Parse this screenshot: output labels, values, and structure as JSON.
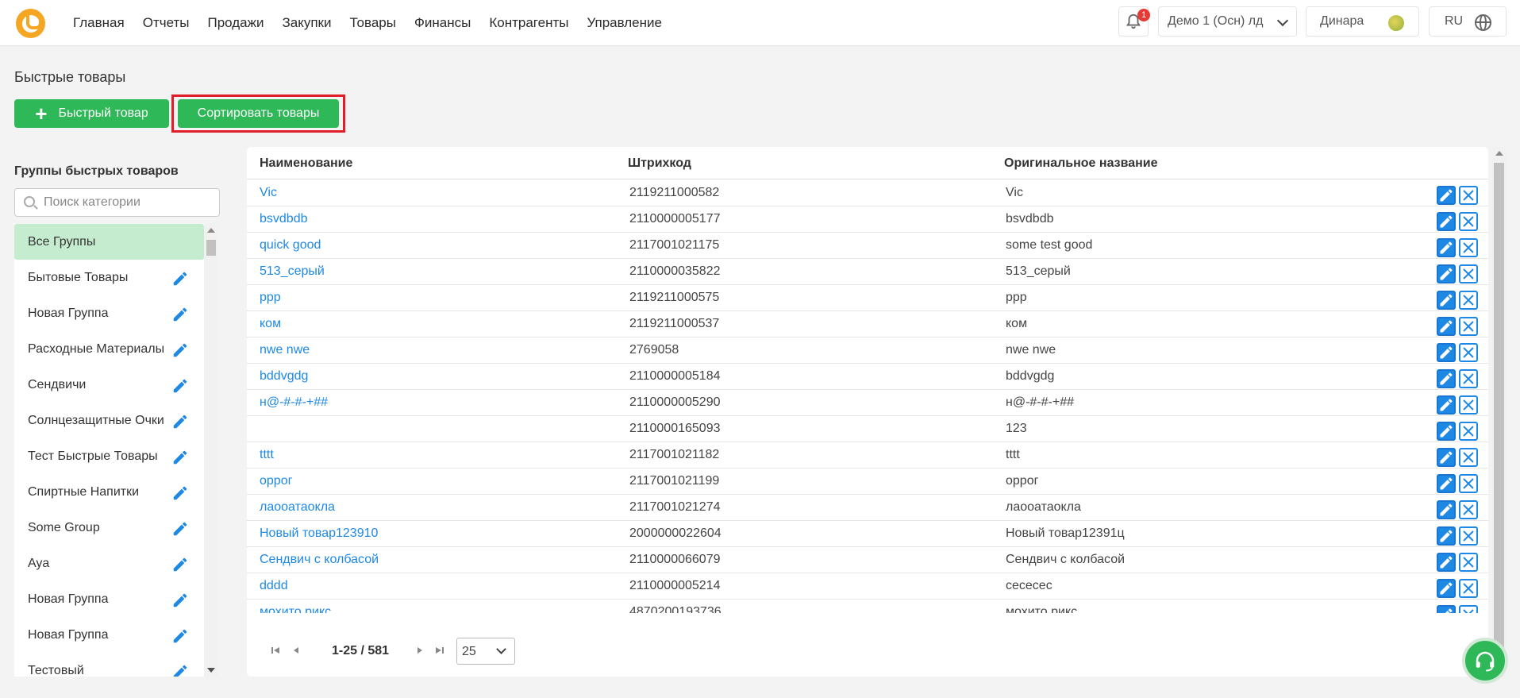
{
  "nav": [
    "Главная",
    "Отчеты",
    "Продажи",
    "Закупки",
    "Товары",
    "Финансы",
    "Контрагенты",
    "Управление"
  ],
  "header": {
    "notifications_count": "1",
    "store": "Демо 1 (Осн) лд",
    "user": "Динара",
    "lang": "RU"
  },
  "page": {
    "title": "Быстрые товары",
    "add_button": "Быстрый товар",
    "sort_button": "Сортировать товары"
  },
  "sidebar": {
    "title": "Группы быстрых товаров",
    "search_placeholder": "Поиск категории",
    "groups": [
      "Все Группы",
      "Бытовые Товары",
      "Новая Группа",
      "Расходные Материалы",
      "Сендвичи",
      "Солнцезащитные Очки",
      "Тест Быстрые Товары",
      "Спиртные Напитки",
      "Some Group",
      "Aya",
      "Новая Группа",
      "Новая Группа",
      "Тестовый"
    ]
  },
  "table": {
    "columns": [
      "Наименование",
      "Штрихкод",
      "Оригинальное название"
    ],
    "rows": [
      [
        "Vic",
        "2119211000582",
        "Vic"
      ],
      [
        "bsvdbdb",
        "2110000005177",
        "bsvdbdb"
      ],
      [
        "quick good",
        "2117001021175",
        "some test good"
      ],
      [
        "513_серый",
        "2110000035822",
        "513_серый"
      ],
      [
        "ppp",
        "2119211000575",
        "ppp"
      ],
      [
        "ком",
        "2119211000537",
        "ком"
      ],
      [
        "nwe nwe",
        "2769058",
        "nwe nwe"
      ],
      [
        "bddvgdg",
        "2110000005184",
        "bddvgdg"
      ],
      [
        "н@-#-#-+##",
        "2110000005290",
        "н@-#-#-+##"
      ],
      [
        "",
        "2110000165093",
        "123"
      ],
      [
        "tttt",
        "2117001021182",
        "tttt"
      ],
      [
        "оррог",
        "2117001021199",
        "оррог"
      ],
      [
        "лаооатаокла",
        "2117001021274",
        "лаооатаокла"
      ],
      [
        "Новый товар123910",
        "2000000022604",
        "Новый товар12391ц"
      ],
      [
        "Сендвич с колбасой",
        "2110000066079",
        "Сендвич с колбасой"
      ],
      [
        "dddd",
        "2110000005214",
        "сесесес"
      ],
      [
        "мохито рикс",
        "4870200193736",
        "мохито рикс"
      ]
    ]
  },
  "pager": {
    "label": "1-25 / 581",
    "page_size": "25"
  }
}
